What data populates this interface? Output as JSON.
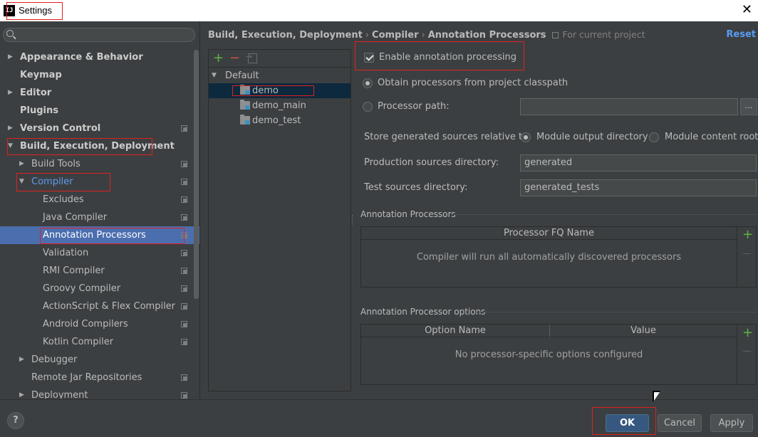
{
  "window": {
    "title": "Settings",
    "app_icon": "IJ",
    "close_icon": "close-icon"
  },
  "search": {
    "placeholder": ""
  },
  "sidebar": {
    "items": [
      {
        "label": "Appearance & Behavior"
      },
      {
        "label": "Keymap"
      },
      {
        "label": "Editor"
      },
      {
        "label": "Plugins"
      },
      {
        "label": "Version Control"
      },
      {
        "label": "Build, Execution, Deployment"
      },
      {
        "label": "Build Tools"
      },
      {
        "label": "Compiler"
      },
      {
        "label": "Excludes"
      },
      {
        "label": "Java Compiler"
      },
      {
        "label": "Annotation Processors"
      },
      {
        "label": "Validation"
      },
      {
        "label": "RMI Compiler"
      },
      {
        "label": "Groovy Compiler"
      },
      {
        "label": "ActionScript & Flex Compiler"
      },
      {
        "label": "Android Compilers"
      },
      {
        "label": "Kotlin Compiler"
      },
      {
        "label": "Debugger"
      },
      {
        "label": "Remote Jar Repositories"
      },
      {
        "label": "Deployment"
      }
    ]
  },
  "breadcrumb": {
    "part1": "Build, Execution, Deployment",
    "part2": "Compiler",
    "part3": "Annotation Processors",
    "separator": "›",
    "scope": "For current project"
  },
  "reset_label": "Reset",
  "profiles": {
    "add_icon": "+",
    "remove_icon": "−",
    "root": "Default",
    "modules": [
      "demo",
      "demo_main",
      "demo_test"
    ]
  },
  "options": {
    "enable_processing": "Enable annotation processing",
    "obtain_classpath": "Obtain processors from project classpath",
    "processor_path": "Processor path:",
    "processor_path_value": "",
    "browse": "...",
    "store_relative": "Store generated sources relative to:",
    "module_output": "Module output directory",
    "module_content": "Module content root",
    "production_dir_label": "Production sources directory:",
    "production_dir_value": "generated",
    "test_dir_label": "Test sources directory:",
    "test_dir_value": "generated_tests"
  },
  "processors_section": {
    "title": "Annotation Processors",
    "column": "Processor FQ Name",
    "empty": "Compiler will run all automatically discovered processors"
  },
  "options_section": {
    "title": "Annotation Processor options",
    "col_name": "Option Name",
    "col_value": "Value",
    "empty": "No processor-specific options configured"
  },
  "footer": {
    "help": "?",
    "ok": "OK",
    "cancel": "Cancel",
    "apply": "Apply"
  },
  "colors": {
    "selection": "#4b6eaf",
    "link": "#589df6",
    "highlight_box": "#e02020",
    "add_green": "#5fb341",
    "remove_red": "#d0513c"
  }
}
